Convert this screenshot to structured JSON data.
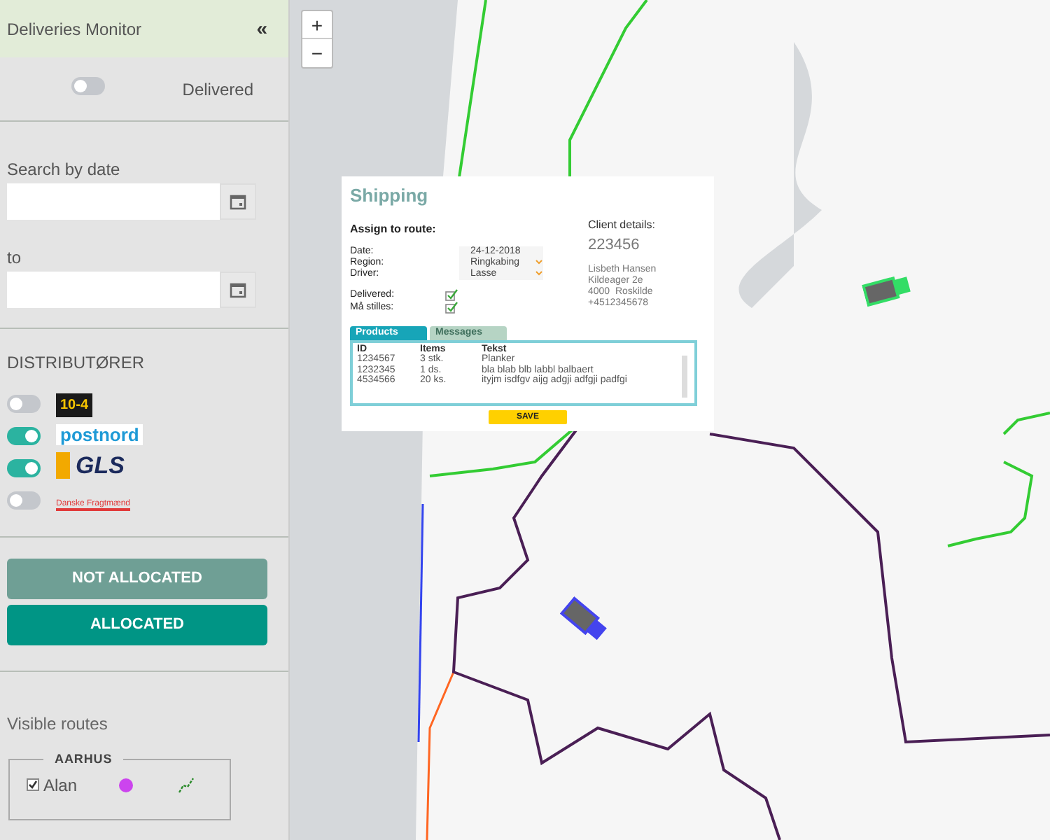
{
  "sidebar": {
    "title": "Deliveries Monitor",
    "collapse_icon": "«",
    "delivered_toggle": {
      "label": "Delivered",
      "on": false
    },
    "date_search": {
      "label": "Search by date",
      "to_label": "to"
    },
    "distributors": {
      "heading": "DISTRIBUTØRER",
      "items": [
        {
          "kind": "ten-four",
          "logo_text": "10-4",
          "on": false
        },
        {
          "kind": "postnord",
          "logo_text": "postnord",
          "on": true
        },
        {
          "kind": "gls",
          "logo_text": "GLS",
          "on": true
        },
        {
          "kind": "fragtmaend",
          "logo_text": "Danske Fragtmænd",
          "on": false
        }
      ]
    },
    "buttons": [
      {
        "label": "NOT ALLOCATED",
        "selected": false
      },
      {
        "label": "ALLOCATED",
        "selected": true
      }
    ],
    "visible_routes": {
      "heading": "Visible routes",
      "groups": [
        {
          "name": "AARHUS",
          "routes": [
            {
              "driver": "Alan",
              "checked": true,
              "color": "#cc44ee"
            }
          ]
        }
      ]
    }
  },
  "map": {
    "zoom_in": "+",
    "zoom_out": "−"
  },
  "shipping": {
    "title": "Shipping",
    "assign_heading": "Assign to route:",
    "fields": [
      {
        "label": "Date:",
        "value": "24-12-2018",
        "kind": "text"
      },
      {
        "label": "Region:",
        "value": "Ringkabing",
        "kind": "select"
      },
      {
        "label": "Driver:",
        "value": "Lasse",
        "kind": "select"
      }
    ],
    "checks": [
      {
        "label": "Delivered:",
        "checked": true
      },
      {
        "label": "Må stilles:",
        "checked": true
      }
    ],
    "client": {
      "heading": "Client details:",
      "number": "223456",
      "lines": [
        "Lisbeth Hansen",
        "Kildeager 2e",
        "4000  Roskilde",
        "+4512345678"
      ]
    },
    "tabs": [
      {
        "label": "Products",
        "selected": true
      },
      {
        "label": "Messages",
        "selected": false
      }
    ],
    "table": {
      "columns": [
        "ID",
        "Items",
        "Tekst"
      ],
      "rows": [
        [
          "1234567",
          "3 stk.",
          "Planker"
        ],
        [
          "1232345",
          "1 ds.",
          "bla blab blb labbl balbaert"
        ],
        [
          "4534566",
          "20 ks.",
          "ityjm isdfgv aijg adgji adfgji padfgi"
        ]
      ]
    },
    "save": "SAVE"
  }
}
